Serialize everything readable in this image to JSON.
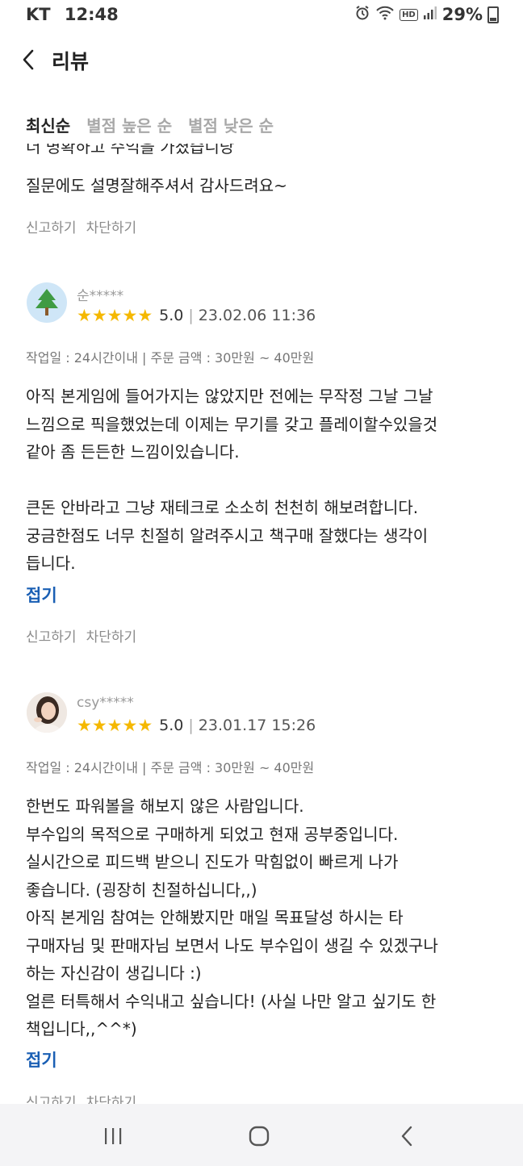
{
  "status_bar": {
    "carrier": "KT",
    "time": "12:48",
    "hd_label": "HD",
    "battery": "29%"
  },
  "header": {
    "title": "리뷰"
  },
  "sort_tabs": [
    "최신순",
    "별점 높은 순",
    "별점 낮은 순"
  ],
  "partial_review": {
    "cut_line": "더 명확하고 수익을 가졌습니당",
    "last_line": "질문에도 설명잘해주셔서 감사드려요~",
    "report_label": "신고하기",
    "block_label": "차단하기"
  },
  "reviews": [
    {
      "name": "순*****",
      "avatar_icon": "tree-icon",
      "rating": "5.0",
      "stars": 5,
      "date": "23.02.06 11:36",
      "meta": "작업일 : 24시간이내 | 주문 금액 : 30만원 ~ 40만원",
      "lines": [
        "아직 본게임에 들어가지는 않았지만 전에는 무작정 그날 그날",
        "느낌으로 픽을했었는데 이제는 무기를 갖고 플레이할수있을것",
        "같아 좀 든든한 느낌이있습니다.",
        "",
        "큰돈 안바라고 그냥 재테크로 소소히 천천히 해보려합니다.",
        "궁금한점도 너무 친절히 알려주시고 책구매 잘했다는 생각이",
        "듭니다."
      ],
      "collapse_label": "접기",
      "report_label": "신고하기",
      "block_label": "차단하기"
    },
    {
      "name": "csy*****",
      "avatar_icon": "person-photo-icon",
      "rating": "5.0",
      "stars": 5,
      "date": "23.01.17 15:26",
      "meta": "작업일 : 24시간이내 | 주문 금액 : 30만원 ~ 40만원",
      "lines": [
        "한번도 파워볼을 해보지 않은 사람입니다.",
        "부수입의 목적으로 구매하게 되었고 현재 공부중입니다.",
        "실시간으로 피드백 받으니 진도가 막힘없이 빠르게 나가",
        "좋습니다. (굉장히 친절하십니다,,)",
        "아직 본게임 참여는 안해봤지만 매일 목표달성 하시는 타",
        "구매자님 및 판매자님 보면서 나도 부수입이 생길 수 있겠구나",
        "하는 자신감이 생깁니다 :)",
        "얼른 터특해서 수익내고 싶습니다! (사실 나만 알고 싶기도 한",
        "책입니다,,^^*)"
      ],
      "collapse_label": "접기",
      "report_label": "신고하기",
      "block_label": "차단하기"
    }
  ]
}
